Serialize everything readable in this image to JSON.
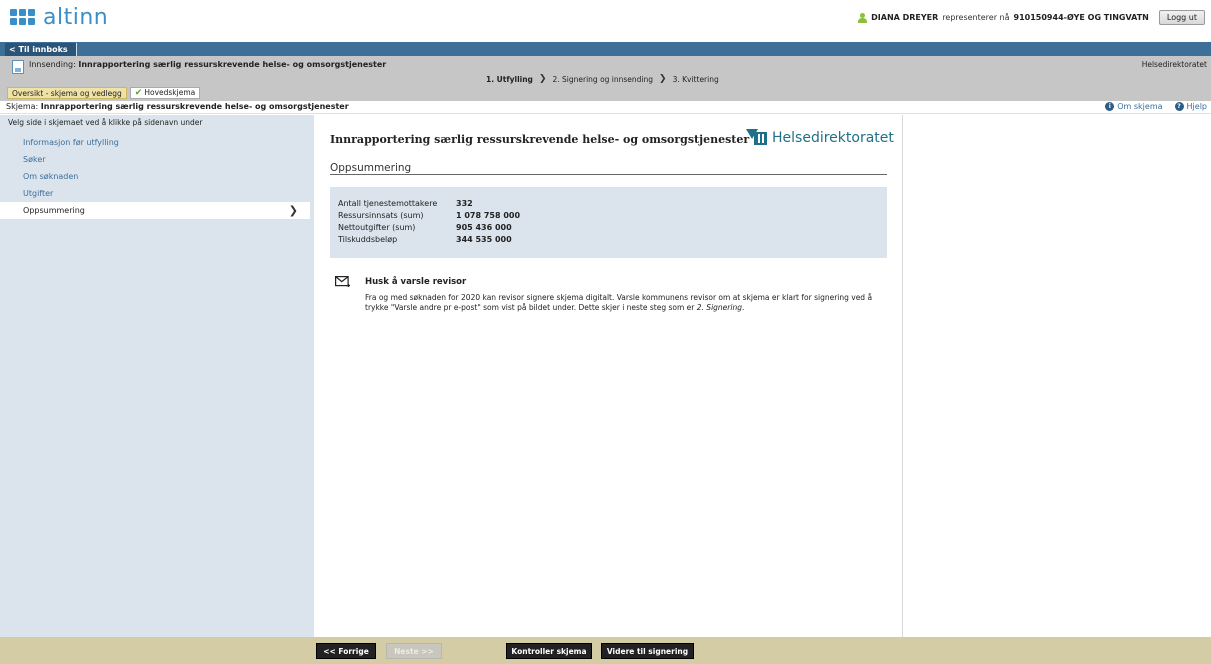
{
  "header": {
    "logo_text": "altinn",
    "user_name": "DIANA DREYER",
    "represents_text": "representerer nå",
    "org": "910150944-ØYE OG TINGVATN",
    "logout_label": "Logg ut"
  },
  "nav": {
    "inbox_label": "< Til innboks"
  },
  "form_header": {
    "innsending_prefix": "Innsending:",
    "innsending_title": "Innrapportering særlig ressurskrevende helse- og omsorgstjenester",
    "agency": "Helsedirektoratet",
    "steps": [
      {
        "label": "1. Utfylling"
      },
      {
        "label": "2. Signering og innsending"
      },
      {
        "label": "3. Kvittering"
      }
    ],
    "tabs": {
      "overview": "Oversikt - skjema og vedlegg",
      "main": "Hovedskjema"
    }
  },
  "schema_line": {
    "prefix": "Skjema:",
    "title": "Innrapportering særlig ressurskrevende helse- og omsorgstjenester",
    "about_label": "Om skjema",
    "help_label": "Hjelp"
  },
  "sidebar": {
    "hint": "Velg side i skjemaet ved å klikke på sidenavn under",
    "items": [
      {
        "label": "Informasjon før utfylling"
      },
      {
        "label": "Søker"
      },
      {
        "label": "Om søknaden"
      },
      {
        "label": "Utgifter"
      },
      {
        "label": "Oppsummering"
      }
    ]
  },
  "main": {
    "title": "Innrapportering særlig ressurskrevende helse- og omsorgstjenester",
    "logo_text": "Helsedirektoratet",
    "section_title": "Oppsummering",
    "summary": [
      {
        "key": "Antall tjenestemottakere",
        "value": "332"
      },
      {
        "key": "Ressursinnsats (sum)",
        "value": "1 078 758 000"
      },
      {
        "key": "Nettoutgifter (sum)",
        "value": "905 436 000"
      },
      {
        "key": "Tilskuddsbeløp",
        "value": "344 535 000"
      }
    ],
    "notice": {
      "title": "Husk å varsle revisor",
      "body_main": "Fra og med søknaden for 2020 kan revisor signere skjema digitalt. Varsle kommunens revisor om at skjema er klart for signering ved å trykke \"Varsle andre pr e-post\" som vist på bildet under. Dette skjer i neste steg som er ",
      "body_em": "2. Signering",
      "body_end": "."
    }
  },
  "footer": {
    "prev": "<< Forrige",
    "next": "Neste >>",
    "check": "Kontroller skjema",
    "sign": "Videre til signering"
  },
  "colors": {
    "nav": "#3d6f98",
    "sidebar": "#dbe4ec",
    "footer": "#d4cca5",
    "link": "#3c6e9a",
    "brand": "#3a8fc7"
  }
}
